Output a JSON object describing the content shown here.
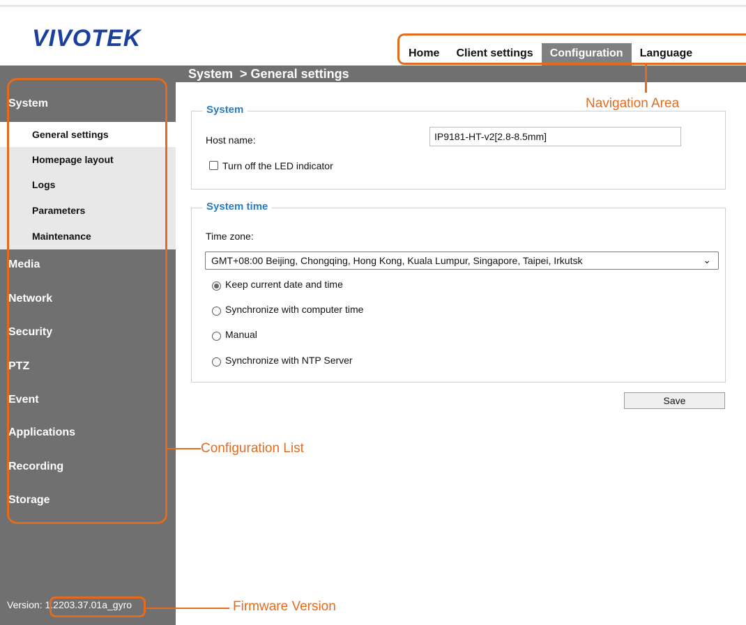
{
  "logo": "VIVOTEK",
  "nav": {
    "tabs": [
      {
        "label": "Home"
      },
      {
        "label": "Client settings"
      },
      {
        "label": "Configuration"
      },
      {
        "label": "Language"
      }
    ]
  },
  "breadcrumb": "System  > General settings",
  "sidebar": {
    "system_label": "System",
    "sub_items": [
      {
        "label": "General settings"
      },
      {
        "label": "Homepage layout"
      },
      {
        "label": "Logs"
      },
      {
        "label": "Parameters"
      },
      {
        "label": "Maintenance"
      }
    ],
    "items": [
      {
        "label": "Media"
      },
      {
        "label": "Network"
      },
      {
        "label": "Security"
      },
      {
        "label": "PTZ"
      },
      {
        "label": "Event"
      },
      {
        "label": "Applications"
      },
      {
        "label": "Recording"
      },
      {
        "label": "Storage"
      }
    ],
    "version": "Version: 1.2203.37.01a_gyro"
  },
  "system_section": {
    "legend": "System",
    "host_name_label": "Host name:",
    "host_name_value": "IP9181-HT-v2[2.8-8.5mm]",
    "led_label": "Turn off the LED indicator"
  },
  "time_section": {
    "legend": "System time",
    "time_zone_label": "Time zone:",
    "time_zone_value": "GMT+08:00 Beijing, Chongqing, Hong Kong, Kuala Lumpur, Singapore, Taipei, Irkutsk",
    "options": [
      {
        "label": "Keep current date and time",
        "checked": true
      },
      {
        "label": "Synchronize with computer time",
        "checked": false
      },
      {
        "label": "Manual",
        "checked": false
      },
      {
        "label": "Synchronize with NTP Server",
        "checked": false
      }
    ]
  },
  "save_label": "Save",
  "annotations": {
    "navigation_area": "Navigation Area",
    "configuration_list": "Configuration List",
    "firmware_version": "Firmware Version"
  },
  "colors": {
    "annotation": "#e26b1e",
    "sidebar_bg": "#707070",
    "legend": "#2b7bc0",
    "logo": "#1b3f9c"
  }
}
